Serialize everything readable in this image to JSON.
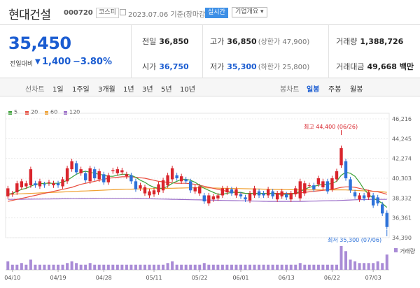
{
  "header": {
    "company": "현대건설",
    "code": "000720",
    "market": "코스피",
    "date_label": "2023.07.06 기준(장마감)",
    "realtime_label": "실시간",
    "company_info_label": "기업개요 ▾"
  },
  "summary": {
    "price": "35,450",
    "change_label": "전일대비",
    "change_arrow": "▼",
    "change_value": "1,400",
    "change_percent": "−3.80%",
    "prev_close_label": "전일",
    "prev_close": "36,850",
    "high_label": "고가",
    "high": "36,850",
    "upper_limit": "(상한가 47,900)",
    "volume_label": "거래량",
    "volume": "1,388,726",
    "open_label": "시가",
    "open": "36,750",
    "low_label": "저가",
    "low": "35,300",
    "lower_limit": "(하한가 25,800)",
    "amount_label": "거래대금",
    "amount": "49,668 백만"
  },
  "tabs": {
    "line_chart": "선차트",
    "periods": [
      "1일",
      "1주일",
      "3개월",
      "1년",
      "3년",
      "5년",
      "10년"
    ],
    "candle_chart": "봉차트",
    "candle_periods": [
      "일봉",
      "주봉",
      "월봉"
    ],
    "selected_candle": "일봉"
  },
  "colors": {
    "up": "#d9252c",
    "down": "#2d72d9",
    "ma5": "#3aa136",
    "ma20": "#e84b3c",
    "ma60": "#f0a030",
    "ma120": "#9a6cc8"
  },
  "chart_data": {
    "type": "candlestick",
    "legend": [
      "5",
      "20",
      "60",
      "120"
    ],
    "y_ticks": [
      46216,
      44245,
      42274,
      40303,
      38332,
      36361,
      34390
    ],
    "ylim": [
      34390,
      46216
    ],
    "x_ticks": [
      "04/10",
      "04/19",
      "04/28",
      "05/11",
      "05/22",
      "06/01",
      "06/13",
      "06/22",
      "07/03"
    ],
    "max_annotation": "최고 44,400 (06/26)",
    "min_annotation": "최저 35,300 (07/06)",
    "volume_label": "거래량",
    "candles": [
      {
        "o": 38500,
        "c": 39300
      },
      {
        "o": 38700,
        "c": 38800
      },
      {
        "o": 38900,
        "c": 39800
      },
      {
        "o": 39400,
        "c": 40000
      },
      {
        "o": 39500,
        "c": 39800
      },
      {
        "o": 39600,
        "c": 41200
      },
      {
        "o": 39800,
        "c": 39600
      },
      {
        "o": 39500,
        "c": 40000
      },
      {
        "o": 39700,
        "c": 39600
      },
      {
        "o": 39800,
        "c": 39900
      },
      {
        "o": 39600,
        "c": 39800
      },
      {
        "o": 39800,
        "c": 39600
      },
      {
        "o": 39500,
        "c": 40200
      },
      {
        "o": 40000,
        "c": 41300
      },
      {
        "o": 41200,
        "c": 42000
      },
      {
        "o": 41800,
        "c": 40900
      },
      {
        "o": 40800,
        "c": 41200
      },
      {
        "o": 40800,
        "c": 40100
      },
      {
        "o": 40000,
        "c": 41300
      },
      {
        "o": 41200,
        "c": 40300
      },
      {
        "o": 40200,
        "c": 41000
      },
      {
        "o": 40700,
        "c": 39900
      },
      {
        "o": 39900,
        "c": 40600
      },
      {
        "o": 41000,
        "c": 41100
      },
      {
        "o": 40800,
        "c": 41200
      },
      {
        "o": 40900,
        "c": 41100
      },
      {
        "o": 40500,
        "c": 40700
      },
      {
        "o": 40600,
        "c": 40000
      },
      {
        "o": 40000,
        "c": 39200
      },
      {
        "o": 39300,
        "c": 39600
      },
      {
        "o": 38800,
        "c": 39400
      },
      {
        "o": 38600,
        "c": 39000
      },
      {
        "o": 38700,
        "c": 39100
      },
      {
        "o": 38900,
        "c": 39700
      },
      {
        "o": 39100,
        "c": 40100
      },
      {
        "o": 39600,
        "c": 40600
      },
      {
        "o": 40200,
        "c": 41300
      },
      {
        "o": 40600,
        "c": 40300
      },
      {
        "o": 40000,
        "c": 40500
      },
      {
        "o": 40200,
        "c": 40000
      },
      {
        "o": 40000,
        "c": 39100
      },
      {
        "o": 39000,
        "c": 39400
      },
      {
        "o": 38800,
        "c": 39500
      },
      {
        "o": 38600,
        "c": 38000
      },
      {
        "o": 37800,
        "c": 38600
      },
      {
        "o": 38200,
        "c": 38500
      },
      {
        "o": 38300,
        "c": 38600
      },
      {
        "o": 38600,
        "c": 39300
      },
      {
        "o": 38900,
        "c": 39300
      },
      {
        "o": 39200,
        "c": 38800
      },
      {
        "o": 38600,
        "c": 39200
      },
      {
        "o": 38700,
        "c": 38500
      },
      {
        "o": 38400,
        "c": 38200
      },
      {
        "o": 38100,
        "c": 38800
      },
      {
        "o": 38600,
        "c": 39300
      },
      {
        "o": 39000,
        "c": 38600
      },
      {
        "o": 38800,
        "c": 38600
      },
      {
        "o": 38600,
        "c": 39200
      },
      {
        "o": 39000,
        "c": 38500
      },
      {
        "o": 38200,
        "c": 38800
      },
      {
        "o": 38500,
        "c": 39000
      },
      {
        "o": 38700,
        "c": 38400
      },
      {
        "o": 38200,
        "c": 38800
      },
      {
        "o": 38700,
        "c": 39300
      },
      {
        "o": 38300,
        "c": 40000
      },
      {
        "o": 38800,
        "c": 39800
      },
      {
        "o": 39600,
        "c": 39600
      },
      {
        "o": 39600,
        "c": 39200
      },
      {
        "o": 39700,
        "c": 40300
      },
      {
        "o": 39400,
        "c": 40000
      },
      {
        "o": 40000,
        "c": 39000
      },
      {
        "o": 39200,
        "c": 40300
      },
      {
        "o": 40200,
        "c": 41000
      },
      {
        "o": 41600,
        "c": 43300
      },
      {
        "o": 42000,
        "c": 40300
      },
      {
        "o": 40200,
        "c": 39100
      },
      {
        "o": 38900,
        "c": 38500
      },
      {
        "o": 38200,
        "c": 38600
      },
      {
        "o": 38600,
        "c": 38300
      },
      {
        "o": 38400,
        "c": 38900
      },
      {
        "o": 38600,
        "c": 37600
      },
      {
        "o": 38400,
        "c": 37800
      },
      {
        "o": 37700,
        "c": 36800
      },
      {
        "o": 36850,
        "c": 35450
      }
    ],
    "volume": [
      5,
      3,
      3,
      4,
      3,
      6,
      3,
      3,
      3,
      3,
      3,
      3,
      3,
      4,
      5,
      4,
      3,
      3,
      4,
      3,
      3,
      3,
      3,
      3,
      3,
      3,
      3,
      3,
      3,
      3,
      3,
      3,
      3,
      3,
      3,
      4,
      5,
      3,
      3,
      3,
      3,
      3,
      3,
      4,
      3,
      3,
      3,
      3,
      3,
      3,
      3,
      3,
      3,
      3,
      3,
      3,
      3,
      3,
      3,
      3,
      3,
      3,
      3,
      3,
      4,
      3,
      3,
      3,
      3,
      3,
      3,
      3,
      3,
      14,
      11,
      6,
      5,
      4,
      4,
      4,
      4,
      5,
      4,
      9
    ],
    "ma5": [
      38700,
      38800,
      39000,
      39200,
      39300,
      39500,
      39700,
      39750,
      39800,
      39800,
      39800,
      39800,
      39900,
      40100,
      40400,
      40700,
      40900,
      41000,
      40900,
      40800,
      40700,
      40600,
      40500,
      40500,
      40600,
      40700,
      40700,
      40600,
      40400,
      40100,
      39900,
      39600,
      39400,
      39300,
      39300,
      39500,
      39800,
      40000,
      40200,
      40200,
      40100,
      39900,
      39600,
      39300,
      39100,
      38900,
      38700,
      38700,
      38800,
      38900,
      38900,
      38900,
      38800,
      38800,
      38800,
      38800,
      38800,
      38800,
      38800,
      38700,
      38700,
      38700,
      38700,
      38800,
      39000,
      39200,
      39400,
      39500,
      39600,
      39700,
      39700,
      39800,
      40000,
      40600,
      40900,
      40800,
      40500,
      39900,
      39200,
      38700,
      38300,
      38100,
      37800,
      37400
    ],
    "ma20": [
      38000,
      38100,
      38200,
      38300,
      38400,
      38500,
      38600,
      38700,
      38800,
      38900,
      39000,
      39100,
      39200,
      39300,
      39400,
      39550,
      39700,
      39800,
      39900,
      40000,
      40100,
      40200,
      40300,
      40350,
      40400,
      40450,
      40450,
      40450,
      40400,
      40350,
      40300,
      40200,
      40100,
      40000,
      39950,
      39900,
      39850,
      39800,
      39800,
      39800,
      39750,
      39700,
      39600,
      39500,
      39400,
      39300,
      39200,
      39100,
      39000,
      38950,
      38900,
      38850,
      38800,
      38800,
      38800,
      38800,
      38800,
      38800,
      38800,
      38800,
      38800,
      38800,
      38800,
      38800,
      38850,
      38900,
      38950,
      39000,
      39050,
      39100,
      39150,
      39200,
      39300,
      39400,
      39450,
      39450,
      39400,
      39300,
      39200,
      39100,
      39000,
      38950,
      38850,
      38700
    ],
    "ma60": [
      38700,
      38720,
      38740,
      38760,
      38780,
      38800,
      38820,
      38840,
      38860,
      38880,
      38900,
      38920,
      38940,
      38960,
      38980,
      39000,
      39020,
      39040,
      39060,
      39080,
      39100,
      39120,
      39140,
      39160,
      39180,
      39200,
      39210,
      39220,
      39230,
      39240,
      39250,
      39260,
      39270,
      39280,
      39290,
      39300,
      39310,
      39320,
      39330,
      39340,
      39350,
      39350,
      39350,
      39350,
      39340,
      39330,
      39320,
      39310,
      39300,
      39290,
      39280,
      39270,
      39260,
      39250,
      39240,
      39230,
      39220,
      39210,
      39200,
      39190,
      39180,
      39170,
      39160,
      39150,
      39150,
      39150,
      39150,
      39150,
      39150,
      39150,
      39150,
      39150,
      39150,
      39150,
      39140,
      39120,
      39100,
      39080,
      39050,
      39020,
      39000,
      38980,
      38950,
      38900
    ],
    "ma120": [
      38200,
      38200,
      38210,
      38210,
      38220,
      38220,
      38230,
      38230,
      38240,
      38240,
      38250,
      38250,
      38260,
      38260,
      38270,
      38270,
      38280,
      38280,
      38290,
      38290,
      38300,
      38300,
      38300,
      38300,
      38300,
      38300,
      38300,
      38300,
      38290,
      38280,
      38270,
      38260,
      38250,
      38240,
      38230,
      38220,
      38210,
      38200,
      38190,
      38180,
      38170,
      38160,
      38150,
      38140,
      38130,
      38120,
      38110,
      38100,
      38090,
      38080,
      38070,
      38060,
      38050,
      38040,
      38030,
      38020,
      38010,
      38000,
      38000,
      38000,
      38000,
      38000,
      38000,
      38000,
      38000,
      38010,
      38020,
      38030,
      38040,
      38050,
      38060,
      38070,
      38080,
      38100,
      38120,
      38140,
      38160,
      38170,
      38180,
      38190,
      38200,
      38200,
      38200,
      38200
    ]
  }
}
